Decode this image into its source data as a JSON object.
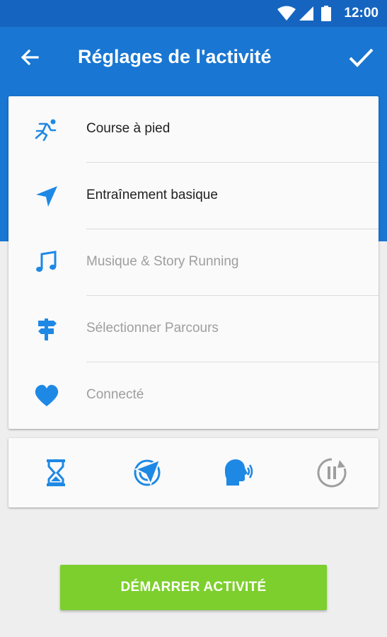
{
  "status_bar": {
    "time": "12:00",
    "icons": [
      "wifi-icon",
      "signal-icon",
      "battery-icon"
    ]
  },
  "app_bar": {
    "title": "Réglages de l'activité",
    "back_icon": "arrow-back-icon",
    "confirm_icon": "check-icon"
  },
  "settings": {
    "items": [
      {
        "label": "Course à pied",
        "icon": "running-icon",
        "state": "active"
      },
      {
        "label": "Entraînement basique",
        "icon": "navigation-arrow-icon",
        "state": "active"
      },
      {
        "label": "Musique & Story Running",
        "icon": "music-note-icon",
        "state": "disabled"
      },
      {
        "label": "Sélectionner Parcours",
        "icon": "signpost-icon",
        "state": "disabled"
      },
      {
        "label": "Connecté",
        "icon": "heart-icon",
        "state": "disabled"
      }
    ]
  },
  "tools": [
    {
      "icon": "hourglass-icon",
      "enabled": true
    },
    {
      "icon": "target-tracking-icon",
      "enabled": true
    },
    {
      "icon": "voice-coach-icon",
      "enabled": true
    },
    {
      "icon": "auto-pause-icon",
      "enabled": false
    }
  ],
  "start_button": {
    "label": "DÉMARRER ACTIVITÉ"
  },
  "colors": {
    "status_bar": "#1565c0",
    "app_bar": "#1976d2",
    "accent_blue": "#1e88e5",
    "start_green": "#7ccf2c",
    "disabled_gray": "#9e9e9e"
  }
}
